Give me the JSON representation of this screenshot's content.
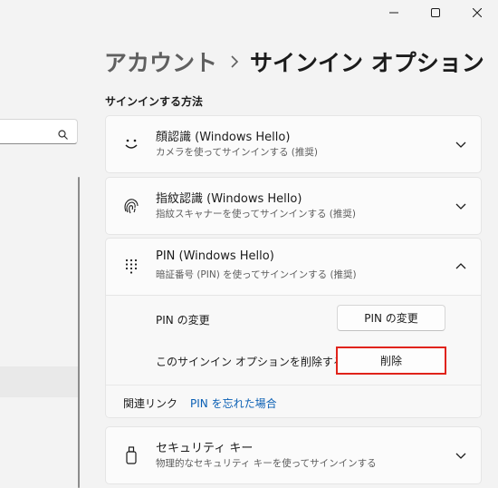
{
  "breadcrumb": {
    "parent": "アカウント",
    "current": "サインイン オプション"
  },
  "section_title": "サインインする方法",
  "options": [
    {
      "title": "顔認識 (Windows Hello)",
      "subtitle": "カメラを使ってサインインする (推奨)",
      "icon": "face-icon",
      "expanded": false
    },
    {
      "title": "指紋認識 (Windows Hello)",
      "subtitle": "指紋スキャナーを使ってサインインする (推奨)",
      "icon": "fingerprint-icon",
      "expanded": false
    },
    {
      "title": "PIN (Windows Hello)",
      "subtitle": "暗証番号 (PIN) を使ってサインインする (推奨)",
      "icon": "keypad-icon",
      "expanded": true
    },
    {
      "title": "セキュリティ キー",
      "subtitle": "物理的なセキュリティ キーを使ってサインインする",
      "icon": "usb-key-icon",
      "expanded": false
    }
  ],
  "pin": {
    "change_label": "PIN の変更",
    "change_button": "PIN の変更",
    "remove_label": "このサインイン オプションを削除する",
    "remove_button": "削除",
    "related_label": "関連リンク",
    "forgot_link": "PIN を忘れた場合"
  },
  "colors": {
    "accent_link": "#0a5fb4",
    "highlight_border": "#e0231a"
  }
}
